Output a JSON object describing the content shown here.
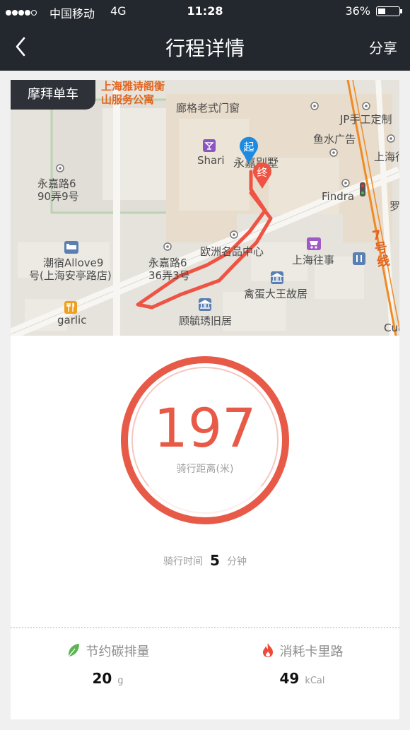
{
  "status_bar": {
    "carrier": "中国移动",
    "network": "4G",
    "time": "11:28",
    "battery": "36%"
  },
  "nav": {
    "title": "行程详情",
    "share": "分享",
    "back_icon": "chevron-left-icon"
  },
  "map": {
    "badge": "摩拜单车",
    "labels": {
      "hotel_line1": "上海雅诗阁衡",
      "hotel_line2": "山服务公寓",
      "langge": "廊格老式门窗",
      "jp": "JP手工定制",
      "yushui": "鱼水广告",
      "shanghai_edge": "上海行",
      "shari": "Shari",
      "yongjia_villa": "永嘉别墅",
      "start": "起",
      "end": "终",
      "yongjia6_90_line1": "永嘉路6",
      "yongjia6_90_line2": "90弄9号",
      "findra": "Findra",
      "luo": "罗",
      "metro_line": "7号线",
      "hotel_allove_line1": "潮宿Allove9",
      "hotel_allove_line2": "号(上海安亭路店)",
      "yongjia6_36_line1": "永嘉路6",
      "yongjia6_36_line2": "36弄3号",
      "ouzhou": "欧洲名品中心",
      "shanghai_wangshi": "上海往事",
      "qindan": "禽蛋大王故居",
      "garlic": "garlic",
      "gu_residence": "顾毓琇旧居",
      "cua": "Cua"
    }
  },
  "ride": {
    "distance_value": "197",
    "distance_label": "骑行距离(米)",
    "time_label": "骑行时间",
    "time_value": "5",
    "time_unit": "分钟"
  },
  "stats": {
    "carbon_label": "节约碳排量",
    "carbon_value": "20",
    "carbon_unit": "g",
    "calorie_label": "消耗卡里路",
    "calorie_value": "49",
    "calorie_unit": "kCal"
  },
  "colors": {
    "accent_red": "#e85a48",
    "leaf_green": "#5bb552",
    "route_red": "#ee5343",
    "start_blue": "#1e8be0",
    "header_dark": "#23272e"
  }
}
